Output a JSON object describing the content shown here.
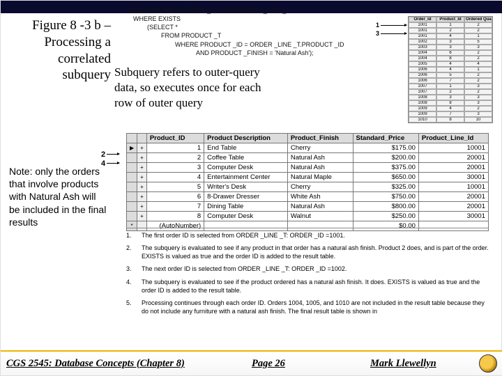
{
  "title_lines": [
    "Figure 8 -3 b –",
    "Processing a",
    "correlated",
    "subquery"
  ],
  "subquery_note": "Subquery refers to outer-query data, so executes once for each row of outer query",
  "side_note": "Note: only the orders that involve products with Natural Ash will be included in the final results",
  "sql": {
    "l1": "SELECT DISTINCT ORDER _ID FROM ORDER _LINE _T",
    "l2": "WHERE EXISTS",
    "l3": "(SELECT *",
    "l4": "FROM PRODUCT _T",
    "l5": "WHERE PRODUCT _ID = ORDER _LINE _T.PRODUCT _ID",
    "l6": "AND PRODUCT _FINISH = 'Natural Ash');"
  },
  "tiny_arrow_labels": [
    "1",
    "3"
  ],
  "tiny_table": {
    "headers": [
      "Order_Id",
      "Product_Id",
      "Ordered Quantity"
    ],
    "rows": [
      [
        "1001",
        "1",
        "2"
      ],
      [
        "1001",
        "2",
        "2"
      ],
      [
        "1001",
        "4",
        "1"
      ],
      [
        "1002",
        "3",
        "5"
      ],
      [
        "1003",
        "3",
        "3"
      ],
      [
        "1004",
        "6",
        "2"
      ],
      [
        "1004",
        "8",
        "2"
      ],
      [
        "1005",
        "4",
        "4"
      ],
      [
        "1006",
        "4",
        "1"
      ],
      [
        "1006",
        "5",
        "2"
      ],
      [
        "1006",
        "7",
        "2"
      ],
      [
        "1007",
        "1",
        "3"
      ],
      [
        "1007",
        "2",
        "2"
      ],
      [
        "1008",
        "3",
        "3"
      ],
      [
        "1008",
        "8",
        "3"
      ],
      [
        "1009",
        "4",
        "2"
      ],
      [
        "1009",
        "7",
        "3"
      ],
      [
        "1010",
        "8",
        "10"
      ]
    ]
  },
  "prod_arrow_labels": [
    "2",
    "4"
  ],
  "product_table": {
    "headers": [
      "Product_ID",
      "Product Description",
      "Product_Finish",
      "Standard_Price",
      "Product_Line_Id"
    ],
    "rows": [
      {
        "id": "1",
        "desc": "End Table",
        "fin": "Cherry",
        "price": "$175.00",
        "line": "10001"
      },
      {
        "id": "2",
        "desc": "Coffee Table",
        "fin": "Natural Ash",
        "price": "$200.00",
        "line": "20001"
      },
      {
        "id": "3",
        "desc": "Computer Desk",
        "fin": "Natural Ash",
        "price": "$375.00",
        "line": "20001"
      },
      {
        "id": "4",
        "desc": "Entertainment Center",
        "fin": "Natural Maple",
        "price": "$650.00",
        "line": "30001"
      },
      {
        "id": "5",
        "desc": "Writer's Desk",
        "fin": "Cherry",
        "price": "$325.00",
        "line": "10001"
      },
      {
        "id": "6",
        "desc": "8-Drawer Dresser",
        "fin": "White Ash",
        "price": "$750.00",
        "line": "20001"
      },
      {
        "id": "7",
        "desc": "Dining Table",
        "fin": "Natural Ash",
        "price": "$800.00",
        "line": "20001"
      },
      {
        "id": "8",
        "desc": "Computer Desk",
        "fin": "Walnut",
        "price": "$250.00",
        "line": "30001"
      }
    ],
    "new_row": {
      "id": "(AutoNumber)",
      "price": "$0.00"
    }
  },
  "steps": [
    {
      "n": "1.",
      "t": "The first order ID is selected from ORDER _LINE _T: ORDER _ID =1001."
    },
    {
      "n": "2.",
      "t": "The subquery is evaluated to see if any product in that order has a natural ash finish. Product 2 does, and is part of the order. EXISTS is valued as true and the order ID is added to the result table."
    },
    {
      "n": "3.",
      "t": "The next order ID is selected from ORDER _LINE _T: ORDER _ID =1002."
    },
    {
      "n": "4.",
      "t": "The subquery is evaluated to see if the product ordered has a natural ash finish. It does. EXISTS is valued as true and the order ID is added to the result table."
    },
    {
      "n": "5.",
      "t": "Processing continues through each order ID. Orders 1004, 1005, and 1010 are not included in the result table because they do not include any furniture with a natural ash finish. The final result table is shown in"
    }
  ],
  "footer": {
    "left": "CGS 2545: Database Concepts  (Chapter 8)",
    "center": "Page 26",
    "right": "Mark Llewellyn"
  }
}
